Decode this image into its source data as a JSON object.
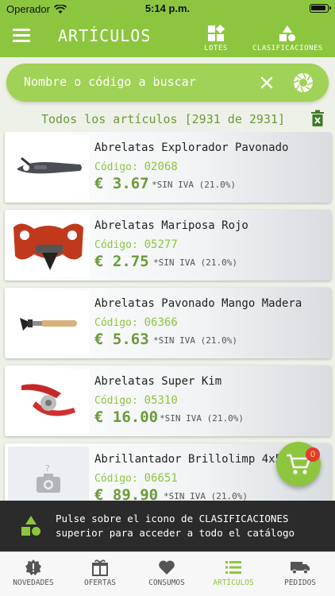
{
  "status_bar": {
    "carrier": "Operador",
    "time": "5:14 p.m."
  },
  "nav": {
    "title": "ARTÍCULOS",
    "actions": [
      {
        "label": "LOTES",
        "icon": "lotes-icon"
      },
      {
        "label": "CLASIFICACIONES",
        "icon": "clasificaciones-icon"
      }
    ]
  },
  "search": {
    "placeholder": "Nombre o código a buscar"
  },
  "list_header": {
    "text": "Todos los artículos [2931 de 2931]"
  },
  "products": [
    {
      "name": "Abrelatas Explorador Pavonado",
      "code_label": "Código:",
      "code": "02068",
      "price": "€ 3.67",
      "iva": "*SIN IVA (21.0%)"
    },
    {
      "name": "Abrelatas Mariposa Rojo",
      "code_label": "Código:",
      "code": "05277",
      "price": "€ 2.75",
      "iva": "*SIN IVA (21.0%)"
    },
    {
      "name": "Abrelatas Pavonado Mango Madera",
      "code_label": "Código:",
      "code": "06366",
      "price": "€ 5.63",
      "iva": "*SIN IVA (21.0%)"
    },
    {
      "name": "Abrelatas Super Kim",
      "code_label": "Código:",
      "code": "05310",
      "price": "€ 16.00",
      "iva": "*SIN IVA (21.0%)"
    },
    {
      "name": "Abrillantador Brillolimp 4x5l C",
      "code_label": "Código:",
      "code": "06651",
      "price": "€ 89.90",
      "iva": "*SIN IVA (21.0%)"
    }
  ],
  "cart": {
    "count": "0"
  },
  "banner": {
    "line1": "Pulse sobre el icono de CLASIFICACIONES",
    "line2": "superior para acceder a todo el catálogo"
  },
  "tabs": [
    {
      "label": "NOVEDADES",
      "icon": "novedades-icon",
      "active": false
    },
    {
      "label": "OFERTAS",
      "icon": "ofertas-icon",
      "active": false
    },
    {
      "label": "CONSUMOS",
      "icon": "consumos-icon",
      "active": false
    },
    {
      "label": "ARTÍCULOS",
      "icon": "articulos-icon",
      "active": true
    },
    {
      "label": "PEDIDOS",
      "icon": "pedidos-icon",
      "active": false
    }
  ],
  "colors": {
    "brand": "#8cc63f",
    "brand_dark": "#6b9b3a",
    "badge": "#e53935",
    "banner": "#2b2b2b"
  }
}
